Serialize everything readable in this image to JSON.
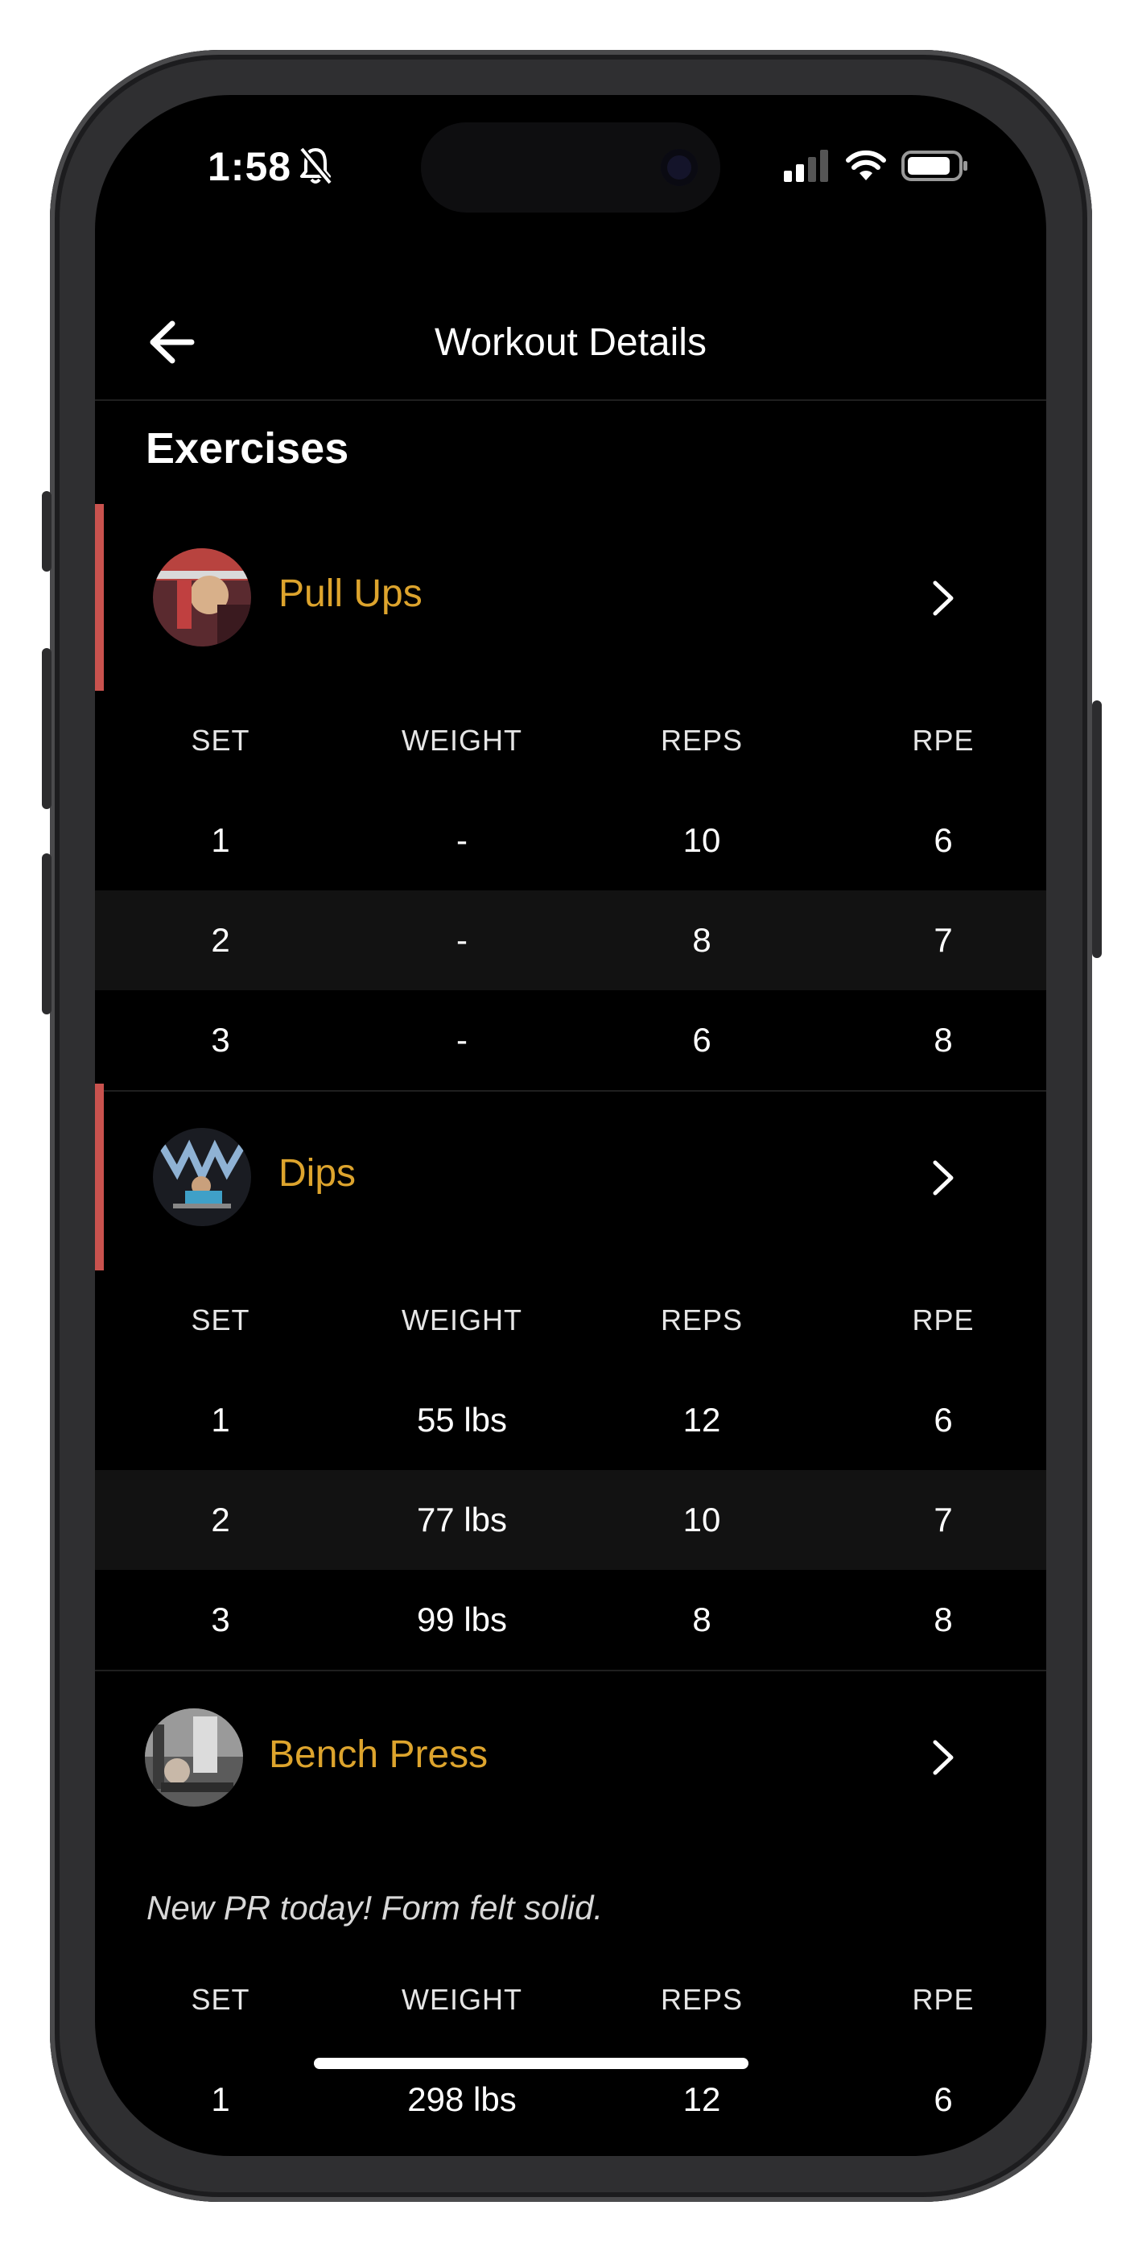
{
  "status_bar": {
    "time": "1:58"
  },
  "header": {
    "title": "Workout Details"
  },
  "section_title": "Exercises",
  "columns": [
    "SET",
    "WEIGHT",
    "REPS",
    "RPE"
  ],
  "exercises": [
    {
      "name": "Pull Ups",
      "note": "",
      "accent_color": "#c9524e",
      "sets": [
        {
          "set": "1",
          "weight": "-",
          "reps": "10",
          "rpe": "6"
        },
        {
          "set": "2",
          "weight": "-",
          "reps": "8",
          "rpe": "7"
        },
        {
          "set": "3",
          "weight": "-",
          "reps": "6",
          "rpe": "8"
        }
      ]
    },
    {
      "name": "Dips",
      "note": "",
      "accent_color": "#c9524e",
      "sets": [
        {
          "set": "1",
          "weight": "55 lbs",
          "reps": "12",
          "rpe": "6"
        },
        {
          "set": "2",
          "weight": "77 lbs",
          "reps": "10",
          "rpe": "7"
        },
        {
          "set": "3",
          "weight": "99 lbs",
          "reps": "8",
          "rpe": "8"
        }
      ]
    },
    {
      "name": "Bench Press",
      "note": "New PR today! Form felt solid.",
      "sets": [
        {
          "set": "1",
          "weight": "298 lbs",
          "reps": "12",
          "rpe": "6"
        }
      ]
    }
  ],
  "colors": {
    "exercise_name": "#dda42d",
    "accent": "#c9524e",
    "background": "#000000"
  }
}
